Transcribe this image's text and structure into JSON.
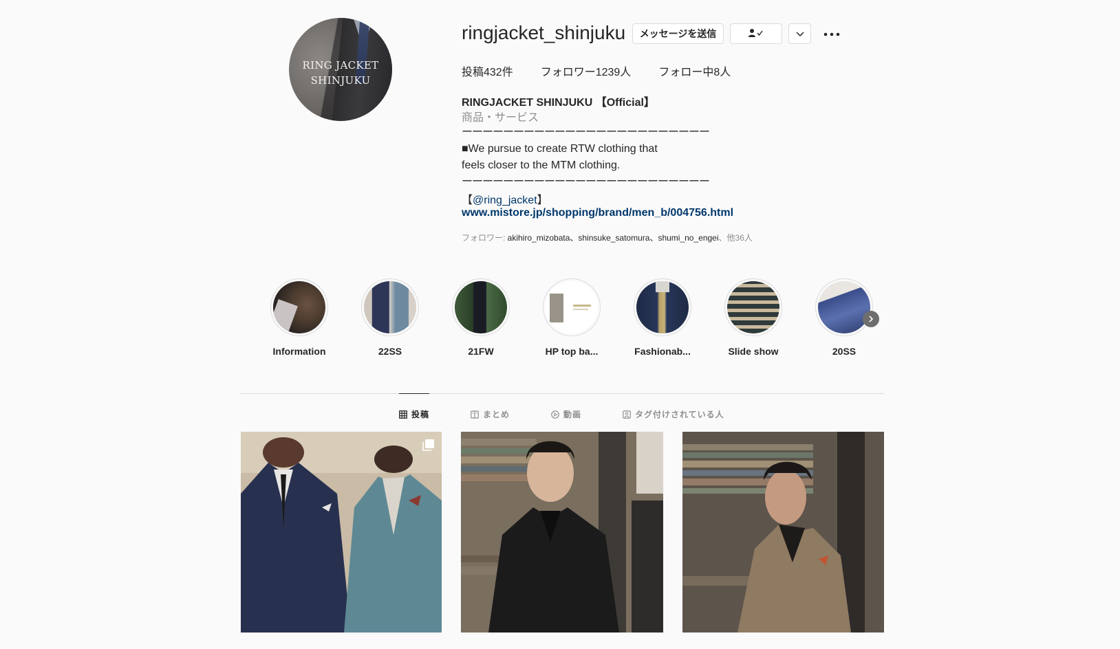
{
  "profile": {
    "avatar_text_line1": "RING JACKET",
    "avatar_text_line2": "SHINJUKU",
    "username": "ringjacket_shinjuku",
    "message_button": "メッセージを送信",
    "stats": {
      "posts": "投稿432件",
      "followers": "フォロワー1239人",
      "following": "フォロー中8人"
    },
    "full_name": "RINGJACKET SHINJUKU 【Official】",
    "category": "商品・サービス",
    "bio_rule": "ーーーーーーーーーーーーーーーーーーーーーーーー",
    "bio_line1": "■We pursue to create RTW clothing that",
    "bio_line2": "feels closer to the MTM clothing.",
    "mention_open": "【",
    "mention_handle": "@ring_jacket",
    "mention_close": "】",
    "website": "www.mistore.jp/shopping/brand/men_b/004756.html",
    "followed_prefix": "フォロワー: ",
    "followed_names": "akihiro_mizobata、shinsuke_satomura、shumi_no_engei",
    "followed_suffix": "、他36人"
  },
  "highlights": [
    {
      "label": "Information"
    },
    {
      "label": "22SS"
    },
    {
      "label": "21FW"
    },
    {
      "label": "HP top ba..."
    },
    {
      "label": "Fashionab..."
    },
    {
      "label": "Slide show"
    },
    {
      "label": "20SS"
    }
  ],
  "tabs": {
    "posts": "投稿",
    "guides": "まとめ",
    "videos": "動画",
    "tagged": "タグ付けされている人"
  },
  "colors": {
    "link": "#00376b",
    "border": "#dbdbdb",
    "muted": "#8e8e8e",
    "text": "#262626"
  }
}
